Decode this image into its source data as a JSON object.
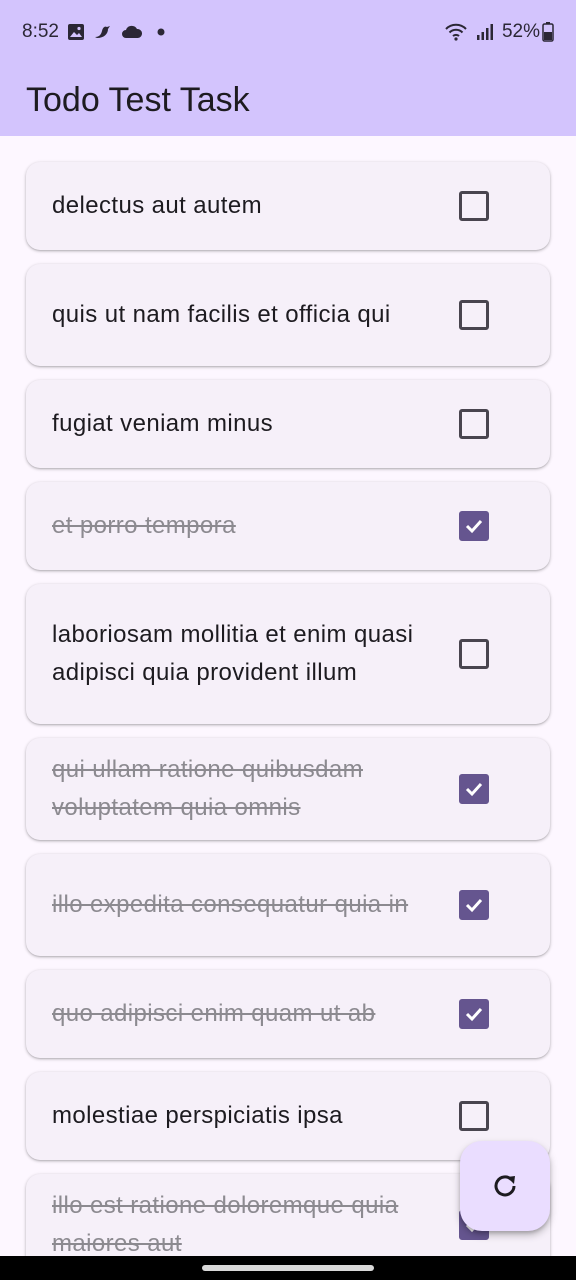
{
  "status_bar": {
    "time": "8:52",
    "left_icons": [
      "image-icon",
      "bird-icon",
      "cloud-icon",
      "dot-icon"
    ],
    "battery": "52%",
    "right_icons": [
      "wifi-icon",
      "signal-icon",
      "battery-icon"
    ]
  },
  "app_bar": {
    "title": "Todo Test Task"
  },
  "todos": [
    {
      "title": "delectus aut autem",
      "completed": false
    },
    {
      "title": "quis ut nam facilis et officia qui",
      "completed": false
    },
    {
      "title": "fugiat veniam minus",
      "completed": false
    },
    {
      "title": "et porro tempora",
      "completed": true
    },
    {
      "title": "laboriosam mollitia et enim quasi adipisci quia provident illum",
      "completed": false
    },
    {
      "title": "qui ullam ratione quibusdam voluptatem quia omnis",
      "completed": true
    },
    {
      "title": "illo expedita consequatur quia in",
      "completed": true
    },
    {
      "title": "quo adipisci enim quam ut ab",
      "completed": true
    },
    {
      "title": "molestiae perspiciatis ipsa",
      "completed": false
    },
    {
      "title": "illo est ratione doloremque quia maiores aut",
      "completed": true
    }
  ],
  "fab": {
    "icon": "refresh-icon"
  },
  "colors": {
    "app_bar": "#d3c4fd",
    "checkbox_checked": "#65558f",
    "fab": "#eaddff",
    "card": "#f6f0f9"
  }
}
